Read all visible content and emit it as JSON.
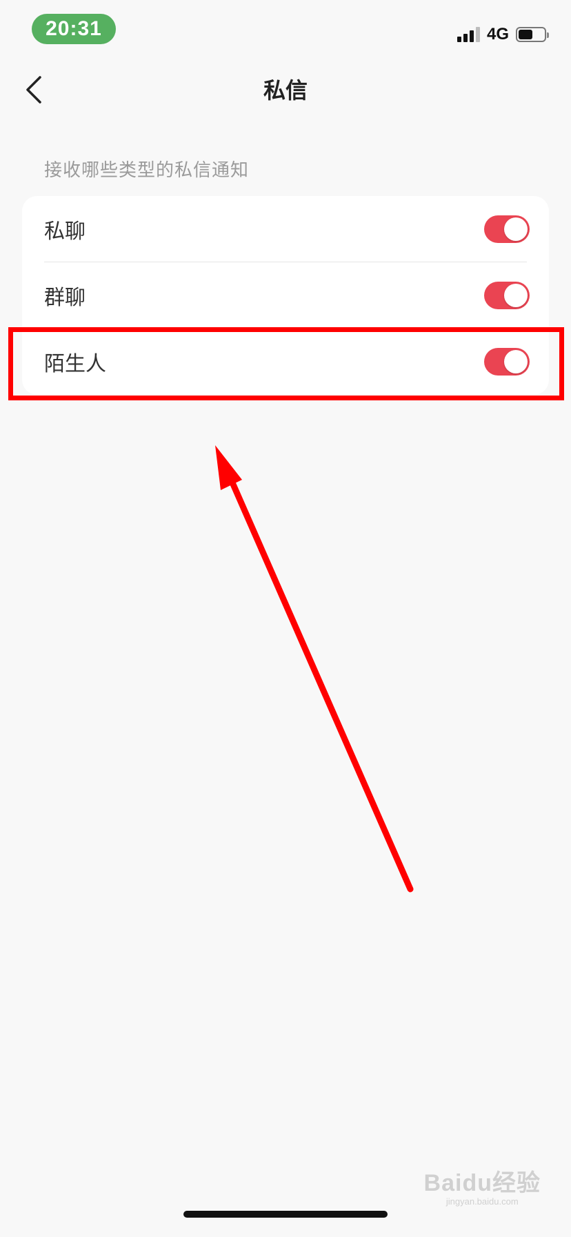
{
  "status_bar": {
    "time": "20:31",
    "network": "4G",
    "battery_level": 0.55
  },
  "nav": {
    "title": "私信",
    "back_icon": "chevron-left-icon"
  },
  "section": {
    "label": "接收哪些类型的私信通知"
  },
  "settings": [
    {
      "label": "私聊",
      "enabled": true
    },
    {
      "label": "群聊",
      "enabled": true
    },
    {
      "label": "陌生人",
      "enabled": true
    }
  ],
  "colors": {
    "accent": "#EA4452",
    "time_pill": "#56B060",
    "annotation": "#FF0000"
  },
  "watermark": {
    "logo": "Baidu经验",
    "sub": "jingyan.baidu.com"
  }
}
